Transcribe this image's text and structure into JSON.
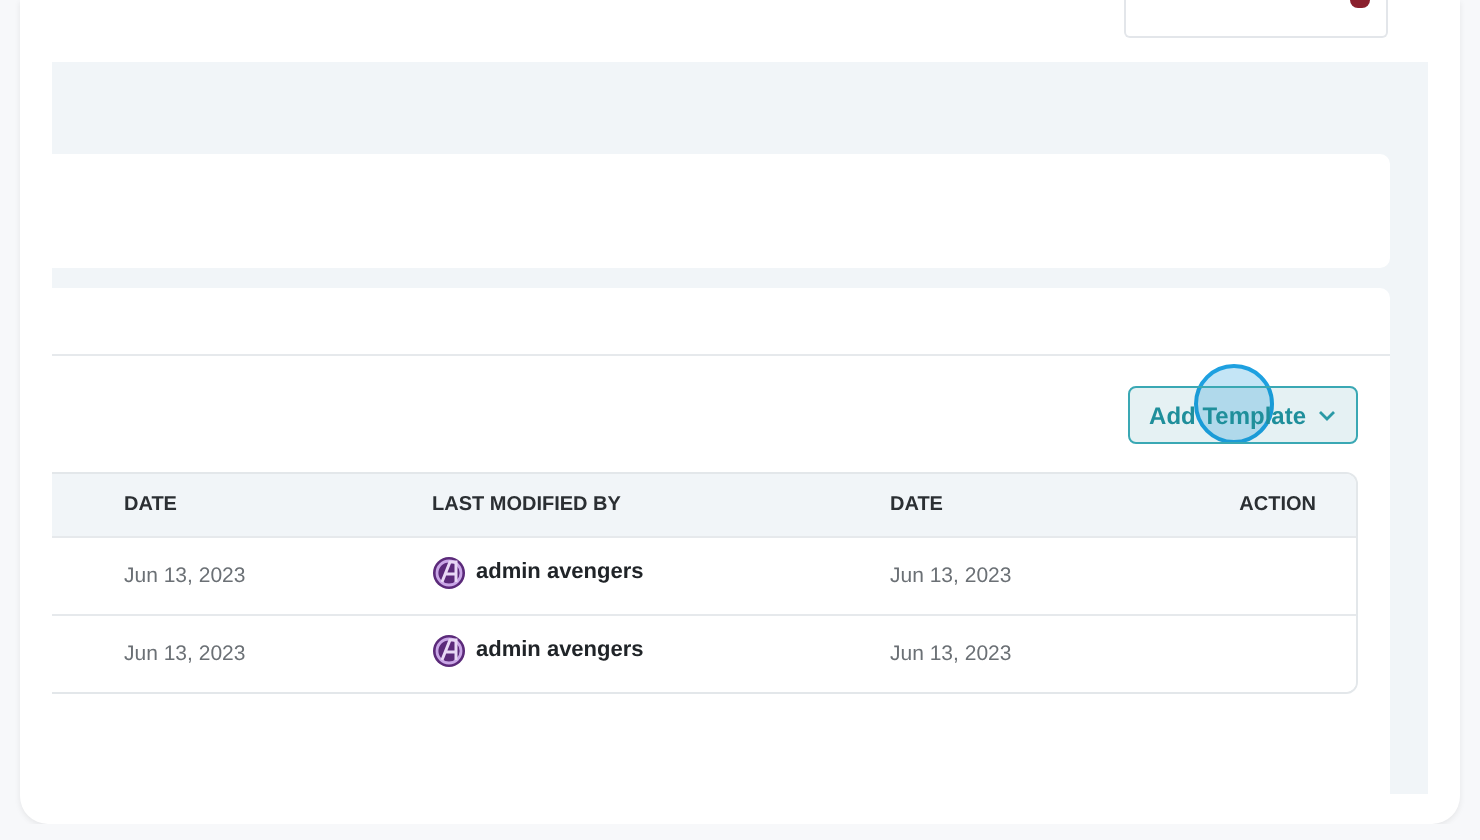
{
  "add_template_button": {
    "label": "Add Template"
  },
  "table": {
    "columns": [
      {
        "label": "DATE"
      },
      {
        "label": "LAST MODIFIED BY"
      },
      {
        "label": "DATE"
      },
      {
        "label": "ACTION"
      }
    ],
    "rows": [
      {
        "date": "Jun 13, 2023",
        "modified_by": "admin avengers",
        "modified_date": "Jun 13, 2023"
      },
      {
        "date": "Jun 13, 2023",
        "modified_by": "admin avengers",
        "modified_date": "Jun 13, 2023"
      }
    ]
  }
}
